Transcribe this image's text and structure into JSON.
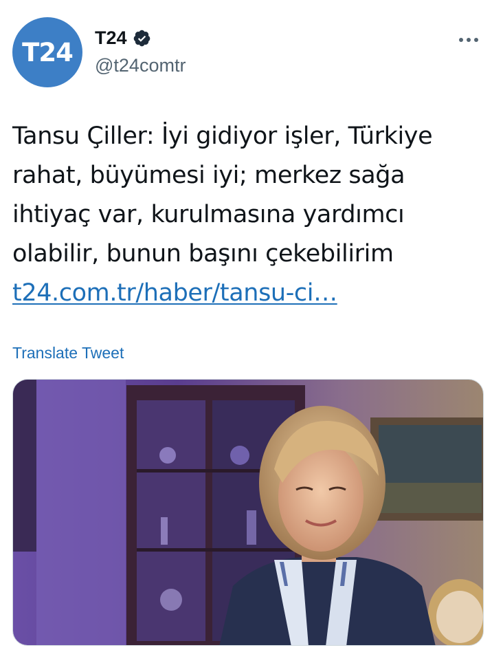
{
  "author": {
    "avatar_text": "T24",
    "display_name": "T24",
    "handle": "@t24comtr",
    "verified": true,
    "avatar_color": "#3d7fc6"
  },
  "tweet": {
    "text_lines": [
      "Tansu Çiller: İyi gidiyor işler, Türkiye",
      "rahat, büyümesi iyi; merkez sağa",
      "ihtiyaç var, kurulmasına yardımcı",
      "olabilir, bunun başını çekebilirim"
    ],
    "link_text": "t24.com.tr/haber/tansu-ci…",
    "translate_label": "Translate Tweet"
  },
  "icons": {
    "verified": "verified-badge-icon",
    "more": "more-options-icon"
  },
  "colors": {
    "link": "#1d6fb8",
    "secondary_text": "#536471",
    "primary_text": "#0f1419"
  }
}
